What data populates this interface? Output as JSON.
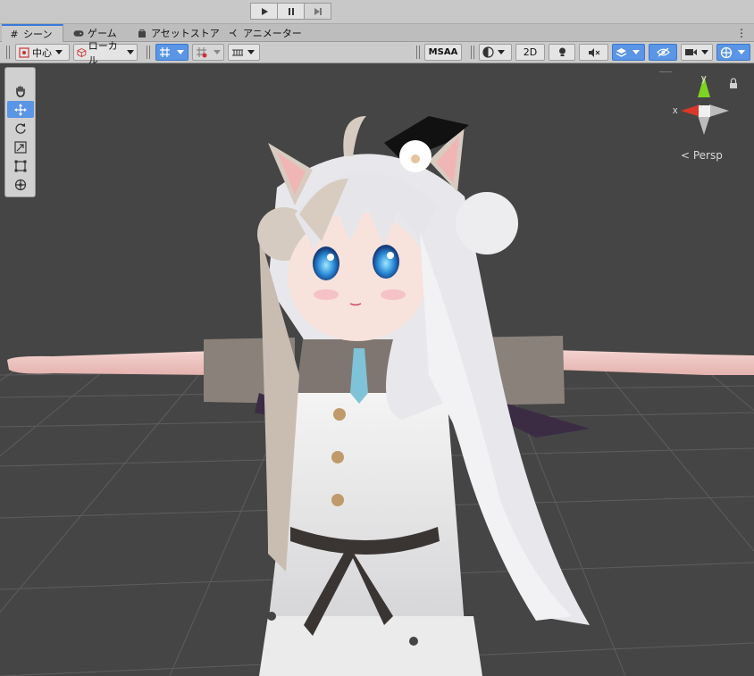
{
  "play_controls": {
    "play": "play-icon",
    "pause": "pause-icon",
    "step": "step-icon"
  },
  "tabs": [
    {
      "label": "シーン",
      "icon": "scene-grid-icon"
    },
    {
      "label": "ゲーム",
      "icon": "gamepad-icon"
    },
    {
      "label": "アセットストア",
      "icon": "bag-icon"
    },
    {
      "label": "アニメーター",
      "icon": "animator-icon"
    }
  ],
  "toolbar": {
    "pivot_label": "中心",
    "space_label": "ローカル",
    "msaa_label": "MSAA",
    "mode_2d_label": "2D"
  },
  "gizmo": {
    "y_label": "y",
    "x_label": "x",
    "persp_label": "< Persp"
  },
  "colors": {
    "viewport_bg": "#454545",
    "accent_blue": "#5a95e6",
    "axis_y": "#7ed321",
    "axis_x": "#d9382b"
  }
}
